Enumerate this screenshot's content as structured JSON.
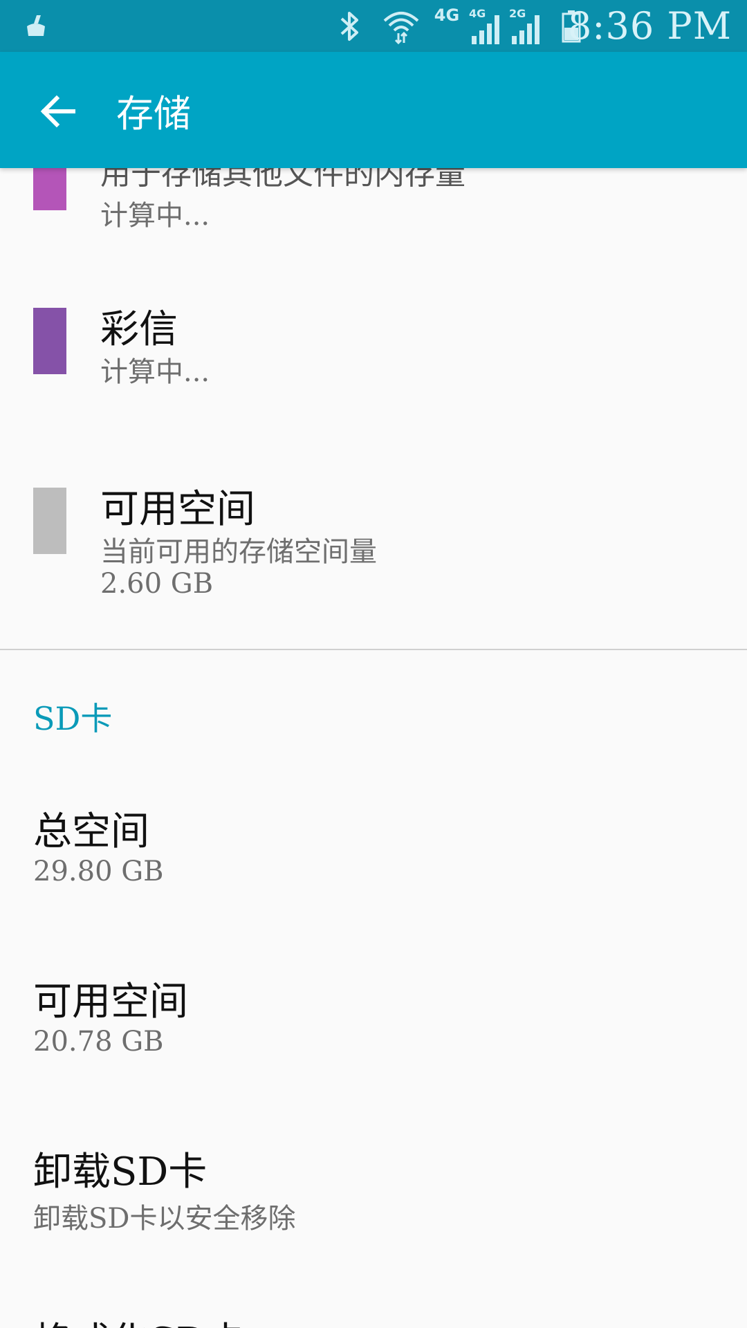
{
  "status_bar": {
    "time": "8:36 PM",
    "network_1": "4G",
    "network_2": "4G",
    "network_3": "2G",
    "icons": [
      "cleaner-icon",
      "bluetooth-icon",
      "wifi-icon",
      "signal-icon",
      "signal-icon",
      "battery-icon"
    ]
  },
  "app_bar": {
    "title": "存储",
    "back_icon": "arrow-left-icon"
  },
  "colors": {
    "status_bar": "#0a8fab",
    "app_bar": "#00a4c4",
    "accent": "#0a9ab8",
    "misc_swatch": "#b455b8",
    "mms_swatch": "#8552a8",
    "free_swatch": "#bdbdbd"
  },
  "internal": {
    "items": [
      {
        "title": "用于存储其他文件的内存量",
        "line1": "计算中..."
      },
      {
        "title": "彩信",
        "line1": "计算中..."
      },
      {
        "title": "可用空间",
        "line1": "当前可用的存储空间量",
        "line2": "2.60 GB"
      }
    ]
  },
  "sd_card": {
    "header": "SD卡",
    "items": [
      {
        "title": "总空间",
        "summary": "29.80 GB"
      },
      {
        "title": "可用空间",
        "summary": "20.78 GB"
      },
      {
        "title": "卸载SD卡",
        "summary": "卸载SD卡以安全移除"
      },
      {
        "title": "格式化SD卡"
      }
    ]
  }
}
